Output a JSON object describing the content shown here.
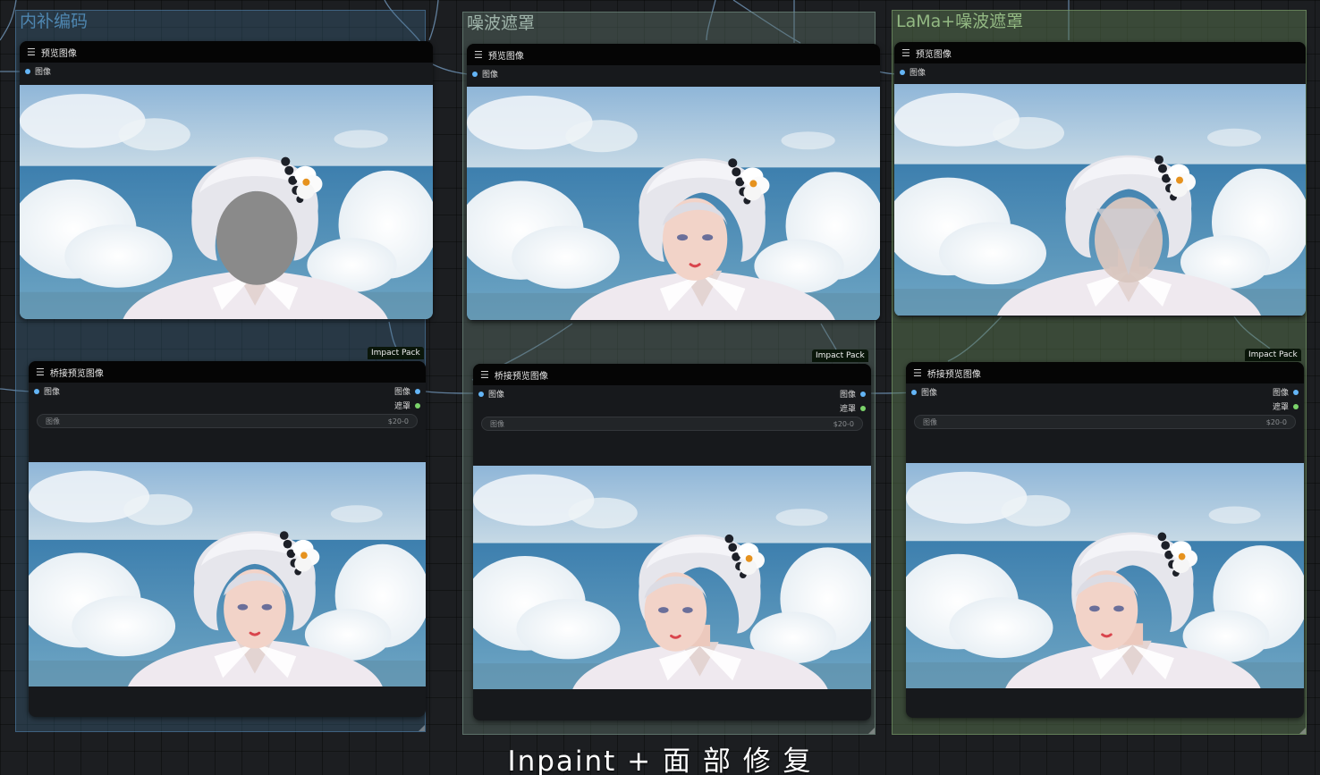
{
  "colors": {
    "canvas": "#1c1e21",
    "group_blue": "#3f6a8a",
    "group_teal": "#5b6f66",
    "group_green": "#5c7a52",
    "link_wire": "#6c8fb1",
    "slot_image": "#64b5f6",
    "slot_mask": "#7bd36a"
  },
  "groups": [
    {
      "title": "内补编码",
      "preview_node": {
        "title": "预览图像",
        "input_label": "图像",
        "image_desc": "masked-face-preview"
      },
      "bridge_node": {
        "title": "桥接预览图像",
        "badge": "Impact Pack",
        "input_label": "图像",
        "output_image_label": "图像",
        "output_mask_label": "遮罩",
        "widget_label": "图像",
        "widget_value": "$20-0"
      }
    },
    {
      "title": "噪波遮罩",
      "preview_node": {
        "title": "预览图像",
        "input_label": "图像",
        "image_desc": "noise-mask-face-preview"
      },
      "bridge_node": {
        "title": "桥接预览图像",
        "badge": "Impact Pack",
        "input_label": "图像",
        "output_image_label": "图像",
        "output_mask_label": "遮罩",
        "widget_label": "图像",
        "widget_value": "$20-0"
      }
    },
    {
      "title": "LaMa+噪波遮罩",
      "preview_node": {
        "title": "预览图像",
        "input_label": "图像",
        "image_desc": "lama-blurred-face-preview"
      },
      "bridge_node": {
        "title": "桥接预览图像",
        "badge": "Impact Pack",
        "input_label": "图像",
        "output_image_label": "图像",
        "output_mask_label": "遮罩",
        "widget_label": "图像",
        "widget_value": "$20-0"
      }
    }
  ],
  "caption": "Inpaint + 面 部 修 复",
  "icons": [
    "hamburger-menu-icon"
  ]
}
